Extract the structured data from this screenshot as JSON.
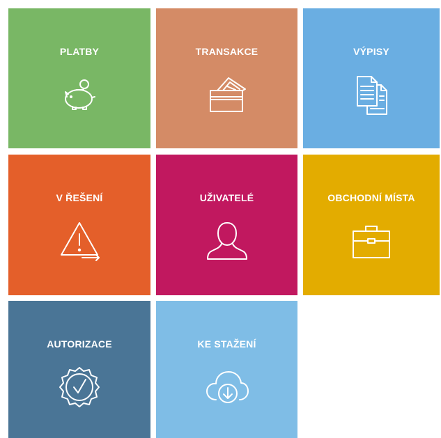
{
  "tiles": [
    {
      "label": "PLATBY",
      "icon": "piggy-bank-icon",
      "color": "#79b765"
    },
    {
      "label": "TRANSAKCE",
      "icon": "credit-card-icon",
      "color": "#d48b66"
    },
    {
      "label": "VÝPISY",
      "icon": "documents-icon",
      "color": "#6aaee2"
    },
    {
      "label": "V ŘEŠENÍ",
      "icon": "warning-icon",
      "color": "#e45f2a"
    },
    {
      "label": "UŽIVATELÉ",
      "icon": "user-icon",
      "color": "#c1185f"
    },
    {
      "label": "OBCHODNÍ MÍSTA",
      "icon": "briefcase-icon",
      "color": "#e3ac00"
    },
    {
      "label": "AUTORIZACE",
      "icon": "certificate-check-icon",
      "color": "#4a7596"
    },
    {
      "label": "KE STAŽENÍ",
      "icon": "cloud-download-icon",
      "color": "#7fbde6"
    }
  ]
}
